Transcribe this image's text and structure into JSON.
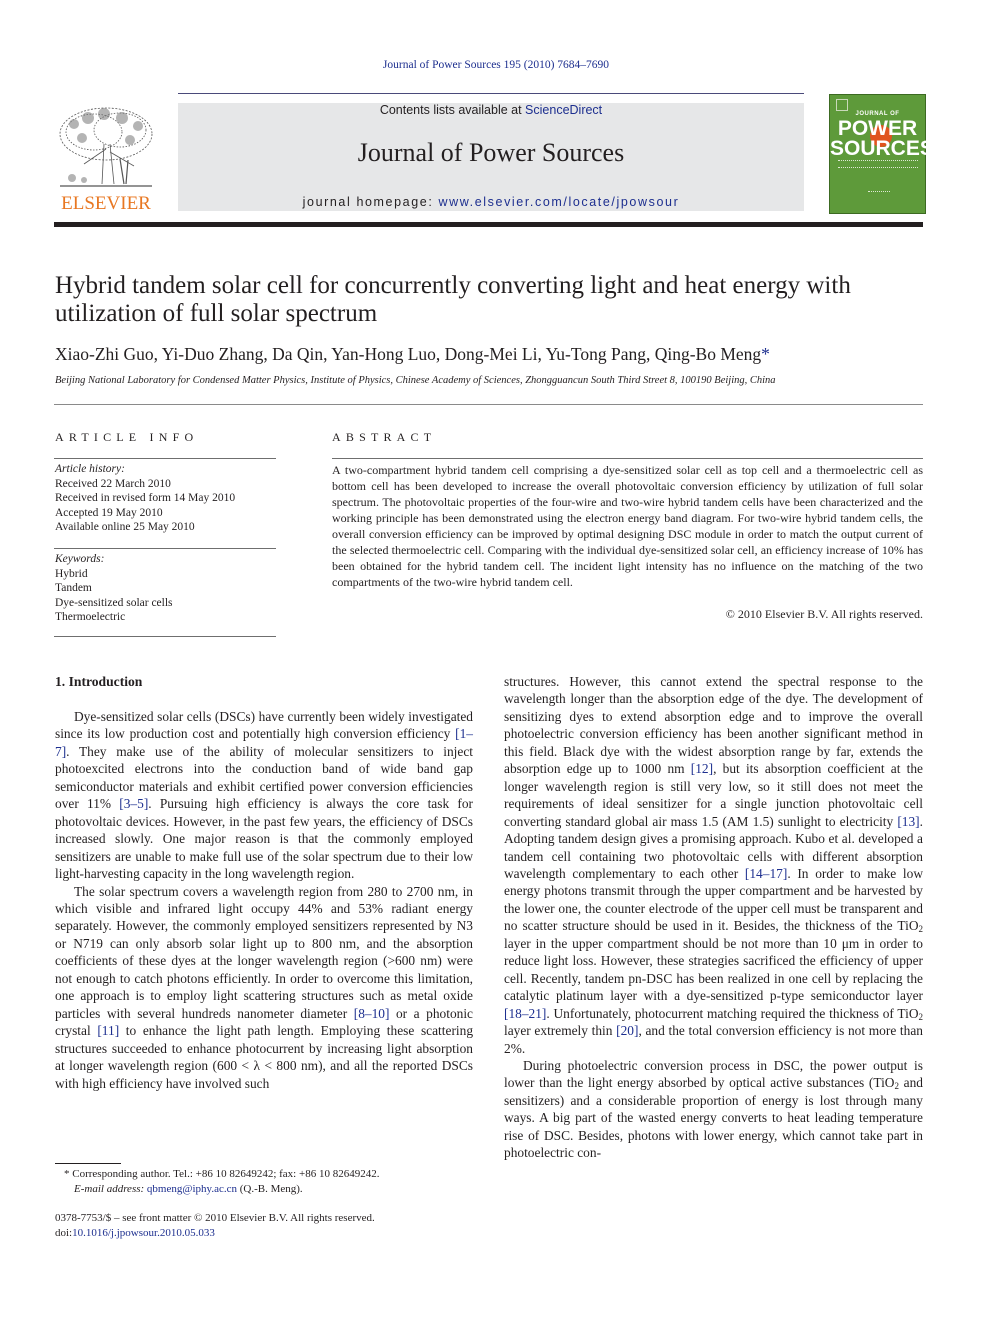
{
  "running_head": "Journal of Power Sources 195 (2010) 7684–7690",
  "masthead": {
    "contents_prefix": "Contents lists available at ",
    "contents_link": "ScienceDirect",
    "journal_name": "Journal of Power Sources",
    "homepage_prefix": "journal homepage: ",
    "homepage_link": "www.elsevier.com/locate/jpowsour",
    "publisher_logo_text": "ELSEVIER",
    "cover_line1": "JOURNAL OF",
    "cover_line2": "POWER",
    "cover_line3": "SOURCES",
    "colors": {
      "brand_orange": "#e87722",
      "link_blue": "#1d2f8f",
      "cover_green": "#5e9a3a",
      "masthead_gray": "#e6e7e8"
    }
  },
  "article": {
    "title": "Hybrid tandem solar cell for concurrently converting light and heat energy with utilization of full solar spectrum",
    "authors": "Xiao-Zhi Guo, Yi-Duo Zhang, Da Qin, Yan-Hong Luo, Dong-Mei Li, Yu-Tong Pang, Qing-Bo Meng",
    "corresponding_marker": "*",
    "affiliation": "Beijing National Laboratory for Condensed Matter Physics, Institute of Physics, Chinese Academy of Sciences, Zhongguancun South Third Street 8, 100190 Beijing, China"
  },
  "article_info": {
    "heading": "ARTICLE INFO",
    "history_label": "Article history:",
    "history": [
      "Received 22 March 2010",
      "Received in revised form 14 May 2010",
      "Accepted 19 May 2010",
      "Available online 25 May 2010"
    ],
    "keywords_label": "Keywords:",
    "keywords": [
      "Hybrid",
      "Tandem",
      "Dye-sensitized solar cells",
      "Thermoelectric"
    ]
  },
  "abstract": {
    "heading": "ABSTRACT",
    "text": "A two-compartment hybrid tandem cell comprising a dye-sensitized solar cell as top cell and a thermoelectric cell as bottom cell has been developed to increase the overall photovoltaic conversion efficiency by utilization of full solar spectrum. The photovoltaic properties of the four-wire and two-wire hybrid tandem cells have been characterized and the working principle has been demonstrated using the electron energy band diagram. For two-wire hybrid tandem cells, the overall conversion efficiency can be improved by optimal designing DSC module in order to match the output current of the selected thermoelectric cell. Comparing with the individual dye-sensitized solar cell, an efficiency increase of 10% has been obtained for the hybrid tandem cell. The incident light intensity has no influence on the matching of the two compartments of the two-wire hybrid tandem cell.",
    "copyright": "© 2010 Elsevier B.V. All rights reserved."
  },
  "body": {
    "section_heading": "1.  Introduction",
    "left": {
      "p1": [
        {
          "t": "Dye-sensitized solar cells (DSCs) have currently been widely investigated since its low production cost and potentially high conversion efficiency "
        },
        {
          "ref": "[1–7]"
        },
        {
          "t": ". They make use of the ability of molecular sensitizers to inject photoexcited electrons into the conduction band of wide band gap semiconductor materials and exhibit certified power conversion efficiencies over 11% "
        },
        {
          "ref": "[3–5]"
        },
        {
          "t": ". Pursuing high efficiency is always the core task for photovoltaic devices. However, in the past few years, the efficiency of DSCs increased slowly. One major reason is that the commonly employed sensitizers are unable to make full use of the solar spectrum due to their low light-harvesting capacity in the long wavelength region."
        }
      ],
      "p2": [
        {
          "t": "The solar spectrum covers a wavelength region from 280 to 2700 nm, in which visible and infrared light occupy 44% and 53% radiant energy separately. However, the commonly employed sensitizers represented by N3 or N719 can only absorb solar light up to 800 nm, and the absorption coefficients of these dyes at the longer wavelength region (>600 nm) were not enough to catch photons efficiently. In order to overcome this limitation, one approach is to employ light scattering structures such as metal oxide particles with several hundreds nanometer diameter "
        },
        {
          "ref": "[8–10]"
        },
        {
          "t": " or a photonic crystal "
        },
        {
          "ref": "[11]"
        },
        {
          "t": " to enhance the light path length. Employing these scattering structures succeeded to enhance photocurrent by increasing light absorption at longer wavelength region (600 < λ < 800 nm), and all the reported DSCs with high efficiency have involved such"
        }
      ]
    },
    "right": {
      "p1": [
        {
          "t": "structures. However, this cannot extend the spectral response to the wavelength longer than the absorption edge of the dye. The development of sensitizing dyes to extend absorption edge and to improve the overall photoelectric conversion efficiency has been another significant method in this field. Black dye with the widest absorption range by far, extends the absorption edge up to 1000 nm "
        },
        {
          "ref": "[12]"
        },
        {
          "t": ", but its absorption coefficient at the longer wavelength region is still very low, so it still does not meet the requirements of ideal sensitizer for a single junction photovoltaic cell converting standard global air mass 1.5 (AM 1.5) sunlight to electricity "
        },
        {
          "ref": "[13]"
        },
        {
          "t": ". Adopting tandem design gives a promising approach. Kubo et al. developed a tandem cell containing two photovoltaic cells with different absorption wavelength complementary to each other "
        },
        {
          "ref": "[14–17]"
        },
        {
          "t": ". In order to make low energy photons transmit through the upper compartment and be harvested by the lower one, the counter electrode of the upper cell must be transparent and no scatter structure should be used in it. Besides, the thickness of the TiO"
        },
        {
          "sub": "2"
        },
        {
          "t": " layer in the upper compartment should be not more than 10 μm in order to reduce light loss. However, these strategies sacrificed the efficiency of upper cell. Recently, tandem pn-DSC has been realized in one cell by replacing the catalytic platinum layer with a dye-sensitized p-type semiconductor layer "
        },
        {
          "ref": "[18–21]"
        },
        {
          "t": ". Unfortunately, photocurrent matching required the thickness of TiO"
        },
        {
          "sub": "2"
        },
        {
          "t": " layer extremely thin "
        },
        {
          "ref": "[20]"
        },
        {
          "t": ", and the total conversion efficiency is not more than 2%."
        }
      ],
      "p2": [
        {
          "t": "During photoelectric conversion process in DSC, the power output is lower than the light energy absorbed by optical active substances (TiO"
        },
        {
          "sub": "2"
        },
        {
          "t": " and sensitizers) and a considerable proportion of energy is lost through many ways. A big part of the wasted energy converts to heat leading temperature rise of DSC. Besides, photons with lower energy, which cannot take part in photoelectric con-"
        }
      ]
    }
  },
  "footnote": {
    "marker": "*",
    "corresponding": "Corresponding author. Tel.: +86 10 82649242; fax: +86 10 82649242.",
    "email_label": "E-mail address: ",
    "email": "qbmeng@iphy.ac.cn",
    "email_suffix": " (Q.-B. Meng)."
  },
  "front_matter": {
    "issn_line": "0378-7753/$ – see front matter © 2010 Elsevier B.V. All rights reserved.",
    "doi_label": "doi:",
    "doi": "10.1016/j.jpowsour.2010.05.033"
  }
}
